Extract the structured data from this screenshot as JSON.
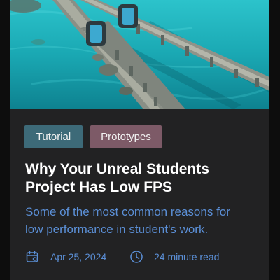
{
  "article": {
    "tags": [
      "Tutorial",
      "Prototypes"
    ],
    "title_line1": "Why Your Unreal Students",
    "title_line2": "Project Has Low FPS",
    "description_line1": "Some of the most common reasons for",
    "description_line2": "low performance in student's work.",
    "date": "Apr 25, 2024",
    "read_time": "24 minute read"
  },
  "icons": {
    "date": "calendar-icon",
    "read_time": "clock-icon"
  },
  "colors": {
    "card_background": "#222223",
    "tag_tutorial": "#3d6a78",
    "tag_prototypes": "#7d5a67",
    "accent_text": "#5b8fd6",
    "title_text": "#ffffff"
  }
}
